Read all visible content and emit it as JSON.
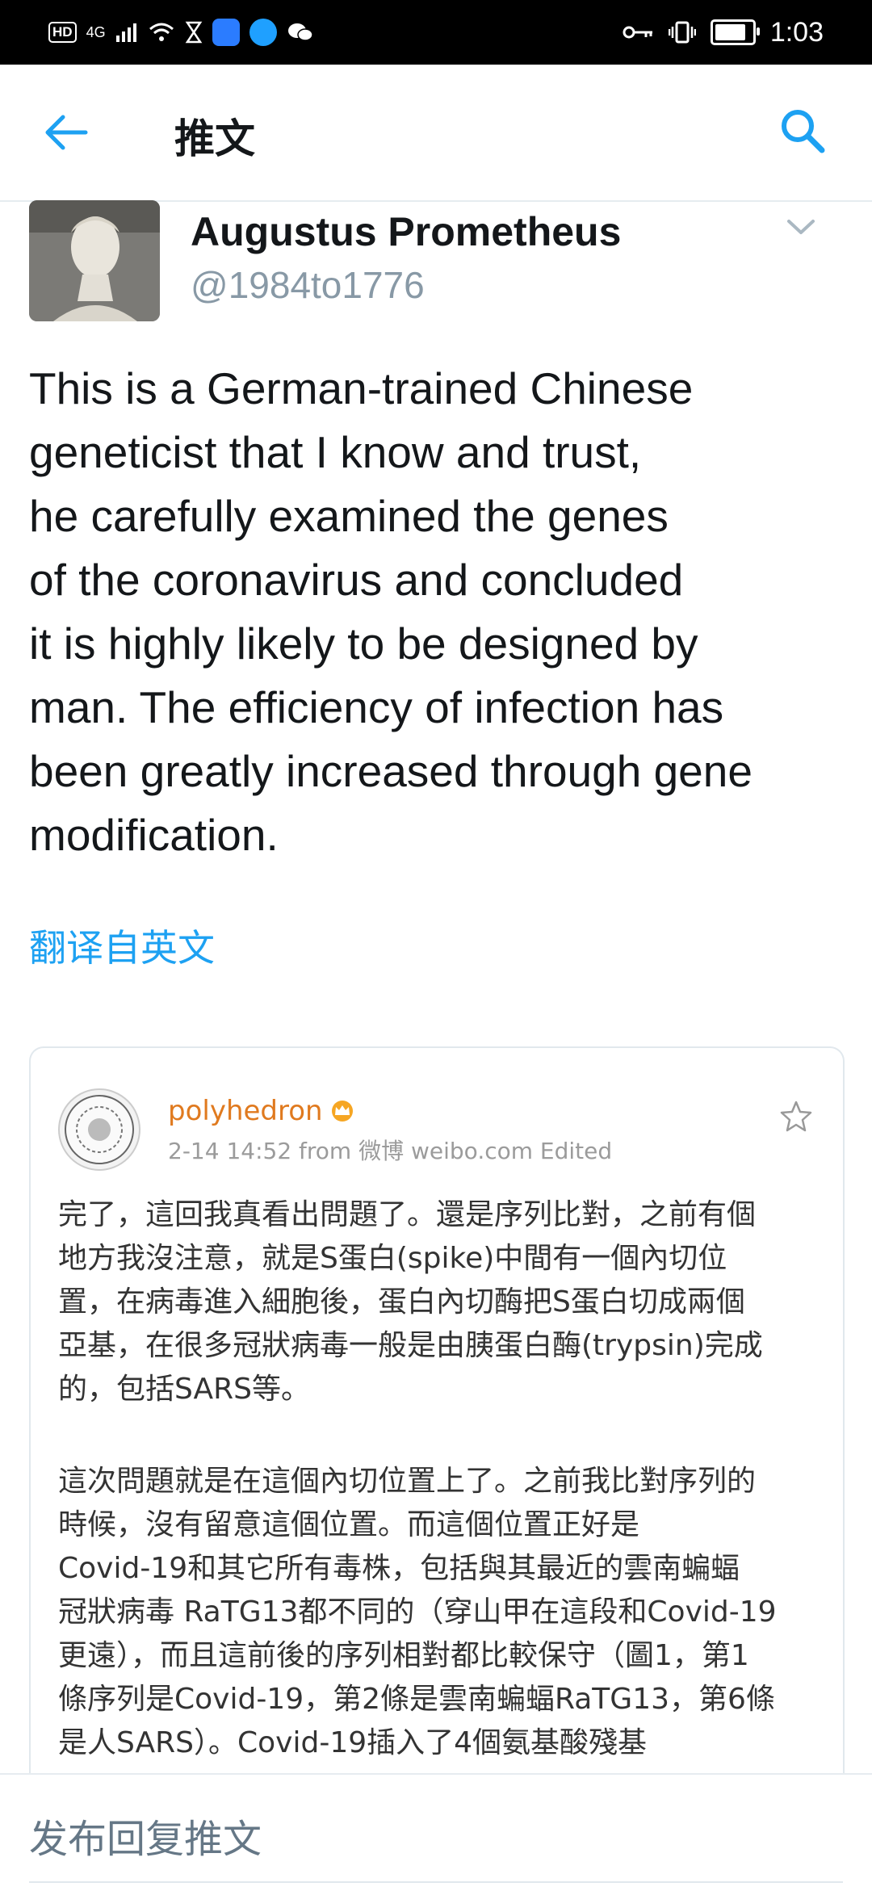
{
  "status_bar": {
    "left_badges": [
      "HD",
      "4G"
    ],
    "time": "1:03",
    "battery_level": 0.85
  },
  "app_bar": {
    "title": "推文"
  },
  "tweet": {
    "author_name": "Augustus Prometheus",
    "author_handle": "@1984to1776",
    "text": "This is a German-trained Chinese\ngeneticist that I know and trust,\nhe carefully examined the genes\nof the coronavirus and concluded\nit is highly likely to be designed by\nman. The efficiency of infection has\nbeen greatly increased through gene\nmodification.",
    "translate_label": "翻译自英文"
  },
  "embedded_post": {
    "user": "polyhedron",
    "meta": "2-14 14:52  from 微博 weibo.com  Edited",
    "paragraph1": "完了，這回我真看出問題了。還是序列比對，之前有個\n地方我沒注意，就是S蛋白(spike)中間有一個內切位\n置，在病毒進入細胞後，蛋白內切酶把S蛋白切成兩個\n亞基，在很多冠狀病毒一般是由胰蛋白酶(trypsin)完成\n的，包括SARS等。",
    "paragraph2": "這次問題就是在這個內切位置上了。之前我比對序列的\n時候，沒有留意這個位置。而這個位置正好是\nCovid-19和其它所有毒株，包括與其最近的雲南蝙蝠\n冠狀病毒 RaTG13都不同的（穿山甲在這段和Covid-19\n更遠），而且這前後的序列相對都比較保守（圖1，第1\n條序列是Covid-19，第2條是雲南蝙蝠RaTG13，第6條\n是人SARS）。Covid-19插入了4個氨基酸殘基"
  },
  "reply_bar": {
    "placeholder": "发布回复推文"
  },
  "colors": {
    "twitter_blue": "#1da1f2",
    "weibo_orange": "#e07a1f"
  }
}
